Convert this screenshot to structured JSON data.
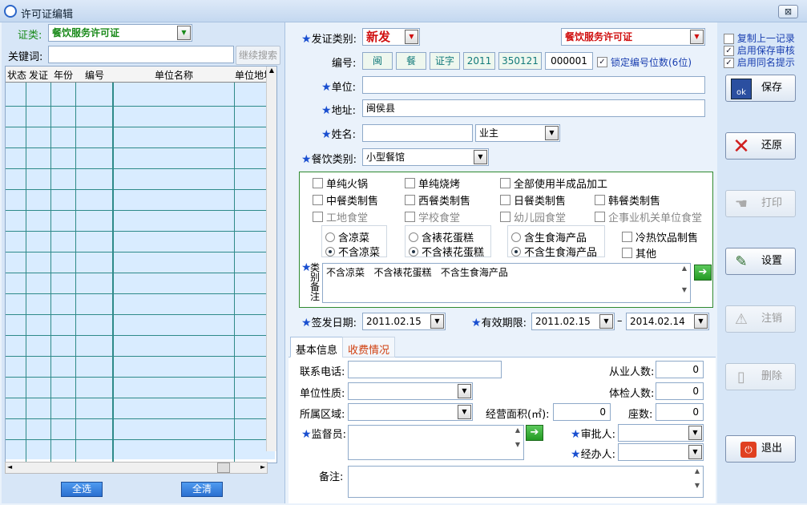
{
  "window": {
    "title": "许可证编辑",
    "close": "⊠"
  },
  "left": {
    "cert_label": "证类:",
    "cert_value": "餐饮服务许可证",
    "keyword_label": "关键词:",
    "keyword_value": "",
    "continue_search": "继续搜索",
    "columns": [
      "状态",
      "发证",
      "年份",
      "编号",
      "单位名称",
      "单位地址"
    ],
    "select_all": "全选",
    "clear_all": "全清"
  },
  "form": {
    "issue_type_label": "发证类别:",
    "issue_type_value": "新发",
    "license_type_value": "餐饮服务许可证",
    "number_label": "编号:",
    "number_parts": [
      "闽",
      "餐",
      "证字",
      "2011",
      "350121",
      "000001"
    ],
    "lock_digits_label": "锁定编号位数(6位)",
    "unit_label": "单位:",
    "unit_value": "",
    "address_label": "地址:",
    "address_value": "闽侯县",
    "name_label": "姓名:",
    "name_value": "",
    "role_value": "业主",
    "food_type_label": "餐饮类别:",
    "food_type_value": "小型餐馆",
    "checkbox_rows": [
      [
        "单纯火锅",
        "单纯烧烤",
        "全部使用半成品加工"
      ],
      [
        "中餐类制售",
        "西餐类制售",
        "日餐类制售",
        "韩餐类制售"
      ],
      [
        "工地食堂",
        "学校食堂",
        "幼儿园食堂",
        "企事业机关单位食堂"
      ]
    ],
    "radio_group1": [
      "含凉菜",
      "不含凉菜"
    ],
    "radio_group2": [
      "含裱花蛋糕",
      "不含裱花蛋糕"
    ],
    "radio_group3": [
      "含生食海产品",
      "不含生食海产品"
    ],
    "extra_checks": [
      "冷热饮品制售",
      "其他"
    ],
    "remark_label": "类别备注",
    "remark_value": "不含凉菜   不含裱花蛋糕   不含生食海产品",
    "issue_date_label": "签发日期:",
    "issue_date_value": "2011.02.15",
    "valid_label": "有效期限:",
    "valid_from": "2011.02.15",
    "valid_sep": "–",
    "valid_to": "2014.02.14"
  },
  "tabs": [
    "基本信息",
    "收费情况"
  ],
  "basic": {
    "phone_label": "联系电话:",
    "phone_value": "",
    "staff_label": "从业人数:",
    "staff_value": "0",
    "nature_label": "单位性质:",
    "nature_value": "",
    "checked_label": "体检人数:",
    "checked_value": "0",
    "region_label": "所属区域:",
    "region_value": "",
    "area_label": "经营面积(㎡):",
    "area_value": "0",
    "seats_label": "座数:",
    "seats_value": "0",
    "supervisor_label": "监督员:",
    "supervisor_value": "",
    "approver_label": "审批人:",
    "approver_value": "",
    "handler_label": "经办人:",
    "handler_value": "",
    "note_label": "备注:",
    "note_value": ""
  },
  "right": {
    "opt_copy": "复制上一记录",
    "opt_save_review": "启用保存审核",
    "opt_same_name": "启用同名提示",
    "save": "保存",
    "restore": "还原",
    "print": "打印",
    "settings": "设置",
    "cancel": "注销",
    "delete": "删除",
    "exit": "退出"
  }
}
